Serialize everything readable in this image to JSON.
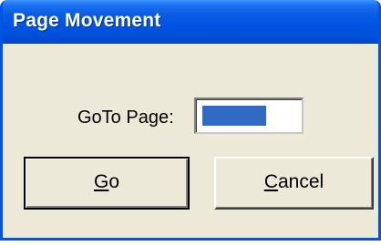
{
  "window": {
    "title": "Page Movement"
  },
  "form": {
    "goto_label": "GoTo Page:",
    "page_value": ""
  },
  "buttons": {
    "go": {
      "mnemonic": "G",
      "rest": "o"
    },
    "cancel": {
      "mnemonic": "C",
      "rest": "ancel"
    }
  },
  "colors": {
    "titlebar": "#0054e3",
    "dialog_background": "#ece9d8",
    "selection": "#316ac5"
  }
}
